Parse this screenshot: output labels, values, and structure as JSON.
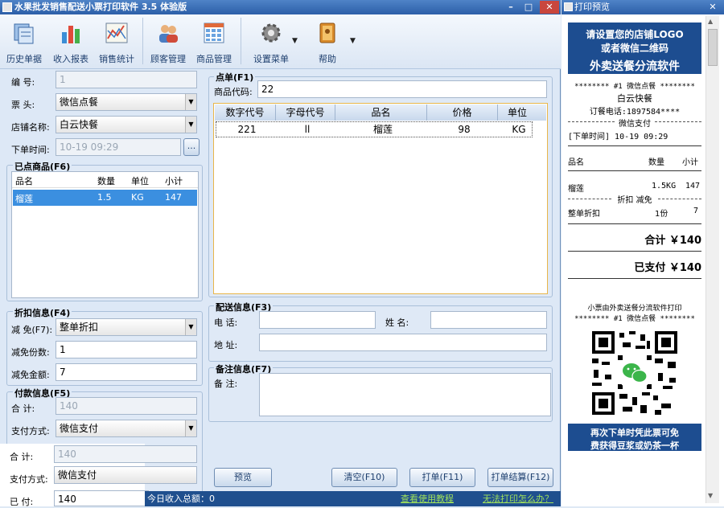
{
  "app": {
    "title": "水果批发销售配送小票打印软件 3.5 体验版"
  },
  "toolbar": {
    "items": [
      {
        "label": "历史单据",
        "icon": "history-icon"
      },
      {
        "label": "收入报表",
        "icon": "bar-chart-icon"
      },
      {
        "label": "销售统计",
        "icon": "line-chart-icon"
      },
      {
        "label": "顾客管理",
        "icon": "users-icon"
      },
      {
        "label": "商品管理",
        "icon": "grid-icon"
      },
      {
        "label": "设置菜单",
        "icon": "gear-icon"
      },
      {
        "label": "帮助",
        "icon": "book-icon"
      }
    ]
  },
  "form": {
    "number_label": "编    号:",
    "number_value": "1",
    "ticket_label": "票    头:",
    "ticket_value": "微信点餐",
    "store_label": "店铺名称:",
    "store_value": "白云快餐",
    "time_label": "下单时间:",
    "time_value": "10-19 09:29",
    "time_btn": "..."
  },
  "ordered": {
    "title": "已点商品(F6)",
    "columns": [
      "品名",
      "数量",
      "单位",
      "小计"
    ],
    "rows": [
      {
        "name": "榴莲",
        "qty": "1.5",
        "unit": "KG",
        "subtotal": "147"
      }
    ]
  },
  "discount": {
    "title": "折扣信息(F4)",
    "mode_label": "减 免(F7):",
    "mode_value": "整单折扣",
    "count_label": "减免份数:",
    "count_value": "1",
    "amount_label": "减免金额:",
    "amount_value": "7"
  },
  "payment": {
    "title": "付款信息(F5)",
    "total_label": "合    计:",
    "total_value": "140",
    "method_label": "支付方式:",
    "method_value": "微信支付",
    "total2_label": "合    计:",
    "total2_value": "140",
    "method2_label": "支付方式:",
    "method2_value": "微信支付",
    "paid_label": "已    付:",
    "paid_value": "140"
  },
  "order": {
    "title": "点单(F1)",
    "code_label": "商品代码:",
    "code_value": "22",
    "columns": [
      "数字代号",
      "字母代号",
      "品名",
      "价格",
      "单位"
    ],
    "rows": [
      {
        "num": "221",
        "alpha": "ll",
        "name": "榴莲",
        "price": "98",
        "unit": "KG"
      }
    ]
  },
  "delivery": {
    "title": "配送信息(F3)",
    "phone_label": "电    话:",
    "name_label": "姓    名:",
    "addr_label": "地    址:"
  },
  "note": {
    "title": "备注信息(F7)",
    "label": "备    注:"
  },
  "buttons": {
    "preview": "预览",
    "clear": "清空(F10)",
    "print": "打单(F11)",
    "print_settle": "打单结算(F12)"
  },
  "status": {
    "today": "今日收入总额：0",
    "tutorial": "查看使用教程",
    "cannot_print": "无法打印怎么办？"
  },
  "preview": {
    "title": "打印预览",
    "banner1": "请设置您的店铺LOGO",
    "banner2": "或者微信二维码",
    "banner3": "外卖送餐分流软件",
    "header": "******** #1 微信点餐 ********",
    "store": "白云快餐",
    "phone": "订餐电话:1897584****",
    "pay": "微信支付",
    "time": "[下单时间] 10-19 09:29",
    "col_name": "品名",
    "col_qty": "数量",
    "col_sub": "小计",
    "item_name": "榴莲",
    "item_qty": "1.5KG",
    "item_sub": "147",
    "disc_header": "折扣 减免",
    "disc_name": "整单折扣",
    "disc_qty": "1份",
    "disc_sub": "7",
    "total": "合计 ￥140",
    "paid": "已支付 ￥140",
    "footer_line": "小票由外卖送餐分流软件打印",
    "footer_header": "******** #1 微信点餐 ********",
    "promo1": "再次下单时凭此票可免",
    "promo2": "费获得豆浆或奶茶一杯"
  }
}
